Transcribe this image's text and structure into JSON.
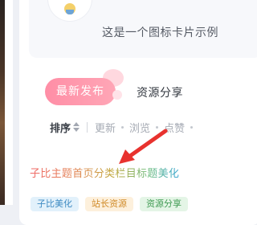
{
  "info_card": {
    "text": "这是一个图标卡片示例"
  },
  "tabs": [
    {
      "label": "最新发布",
      "active": true
    },
    {
      "label": "资源分享",
      "active": false
    }
  ],
  "sort": {
    "label": "排序",
    "options": [
      "更新",
      "浏览",
      "点赞"
    ]
  },
  "gradient_title": "子比主题首页分类栏目标题美化",
  "tags": [
    "子比美化",
    "站长资源",
    "资源分享"
  ],
  "colors": {
    "tab_active": "#ff8ea6",
    "arrow": "#e8322e",
    "gradient_start": "#f06868",
    "gradient_end": "#3ba7d4"
  }
}
